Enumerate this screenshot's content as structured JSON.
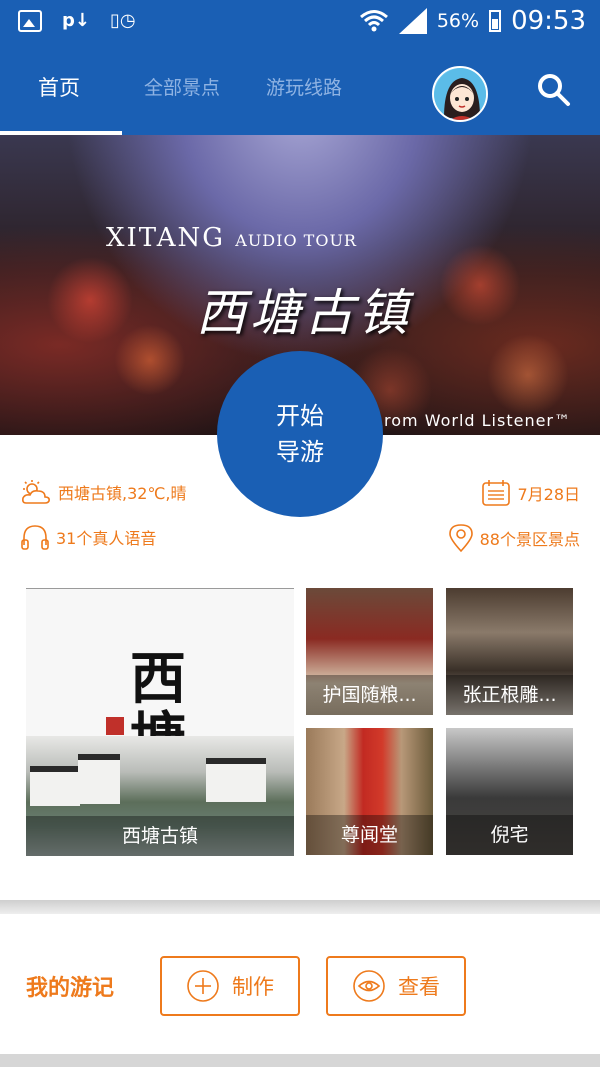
{
  "status_bar": {
    "battery": "56%",
    "time": "09:53"
  },
  "tabs": [
    {
      "label": "首页",
      "active": true
    },
    {
      "label": "全部景点",
      "active": false
    },
    {
      "label": "游玩线路",
      "active": false
    }
  ],
  "banner": {
    "title": "XITANG",
    "subtitle": "AUDIO TOUR",
    "chinese_title": "西塘古镇",
    "credit": "rom World Listener™"
  },
  "start_button": {
    "line1": "开始",
    "line2": "导游"
  },
  "info": {
    "weather": "西塘古镇,32℃,晴",
    "date": "7月28日",
    "voices": "31个真人语音",
    "spots": "88个景区景点"
  },
  "grid": {
    "main": {
      "caption": "西塘古镇",
      "calligraphy_line1": "西",
      "calligraphy_line2": "塘"
    },
    "tiles": [
      {
        "caption": "护国随粮..."
      },
      {
        "caption": "张正根雕..."
      },
      {
        "caption": "尊闻堂"
      },
      {
        "caption": "倪宅"
      }
    ]
  },
  "journal": {
    "title": "我的游记",
    "make_label": "制作",
    "view_label": "查看"
  },
  "colors": {
    "primary": "#1a5fb4",
    "accent": "#ee7a1c"
  }
}
